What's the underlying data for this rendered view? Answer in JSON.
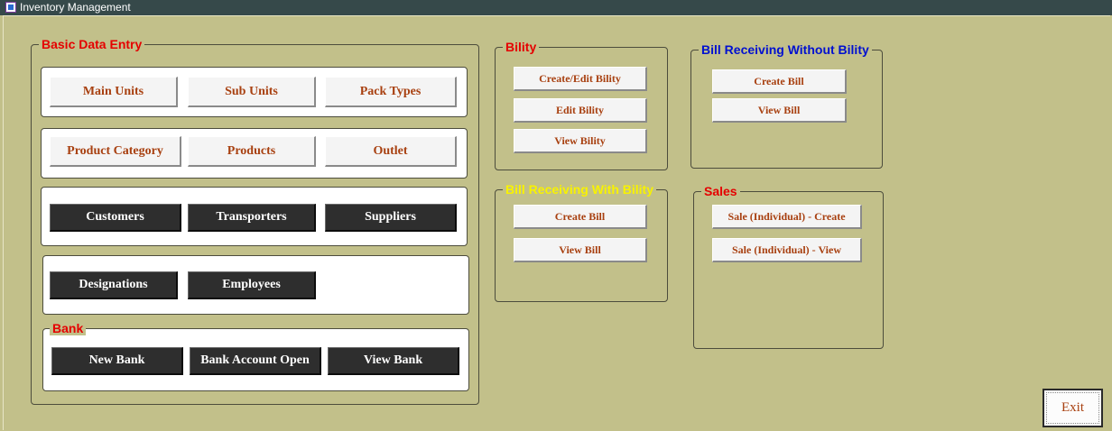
{
  "window": {
    "title": "Inventory Management",
    "icon": "app-window-icon"
  },
  "groups": {
    "basic_data_entry": "Basic Data Entry",
    "bank": "Bank",
    "bility": "Bility",
    "bill_receiving_with_bility": "Bill Receiving With Bility",
    "bill_receiving_without_bility": "Bill Receiving Without Bility",
    "sales": "Sales"
  },
  "colors": {
    "background": "#c2c08a",
    "titlebar": "#36494a",
    "legend_red": "#e50000",
    "legend_yellow": "#f8f200",
    "legend_blue": "#0010d0",
    "button_text": "#a84010",
    "dark_button": "#2e2e2e"
  },
  "basic": {
    "main_units": "Main Units",
    "sub_units": "Sub Units",
    "pack_types": "Pack Types",
    "product_category": "Product Category",
    "products": "Products",
    "outlet": "Outlet",
    "customers": "Customers",
    "transporters": "Transporters",
    "suppliers": "Suppliers",
    "designations": "Designations",
    "employees": "Employees"
  },
  "bank": {
    "new_bank": "New Bank",
    "account_open": "Bank Account Open",
    "view_bank": "View Bank"
  },
  "bility": {
    "create_edit": "Create/Edit Bility",
    "edit": "Edit Bility",
    "view": "View Bility"
  },
  "with_bility": {
    "create_bill": "Create Bill",
    "view_bill": "View Bill"
  },
  "without_bility": {
    "create_bill": "Create Bill",
    "view_bill": "View Bill"
  },
  "sales": {
    "create": "Sale (Individual) - Create",
    "view": "Sale (Individual) - View"
  },
  "exit": "Exit"
}
